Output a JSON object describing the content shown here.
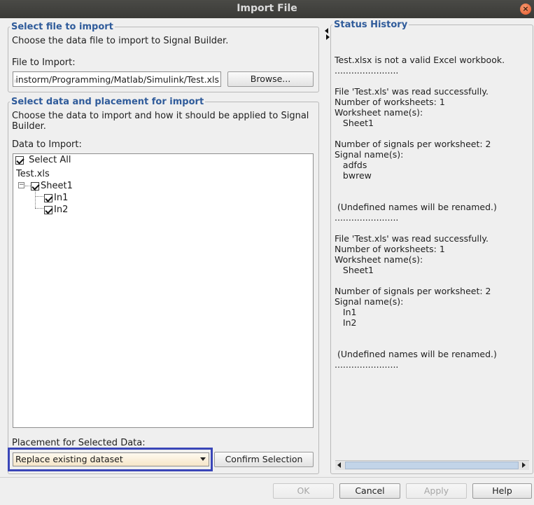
{
  "window": {
    "title": "Import File",
    "close_icon": "close-icon"
  },
  "file_section": {
    "legend": "Select file to import",
    "description": "Choose the data file to import to Signal Builder.",
    "file_label": "File to Import:",
    "file_value": "ainstorm/Programming/Matlab/Simulink/Test.xls",
    "browse_label": "Browse..."
  },
  "data_section": {
    "legend": "Select data and placement for import",
    "description_line1": "Choose the data to import and how it should be applied to Signal",
    "description_line2": "Builder.",
    "data_label": "Data to Import:",
    "select_all_label": "Select All",
    "tree": {
      "file": "Test.xls",
      "sheet": "Sheet1",
      "signals": [
        "In1",
        "In2"
      ]
    },
    "placement_label": "Placement for Selected Data:",
    "placement_value": "Replace existing dataset",
    "confirm_label": "Confirm Selection"
  },
  "status": {
    "legend": "Status History",
    "text": "\nTest.xlsx is not a valid Excel workbook.\n.......................\n\nFile 'Test.xls' was read successfully.\nNumber of worksheets: 1\nWorksheet name(s):\n   Sheet1\n\nNumber of signals per worksheet: 2\nSignal name(s):\n   adfds\n   bwrew\n\n\n (Undefined names will be renamed.)\n.......................\n\nFile 'Test.xls' was read successfully.\nNumber of worksheets: 1\nWorksheet name(s):\n   Sheet1\n\nNumber of signals per worksheet: 2\nSignal name(s):\n   In1\n   In2\n\n\n (Undefined names will be renamed.)\n......................."
  },
  "buttons": {
    "ok": "OK",
    "cancel": "Cancel",
    "apply": "Apply",
    "help": "Help"
  },
  "colors": {
    "legend": "#2f5b9a",
    "highlight": "#3a46b8",
    "titlebar": "#3c3c39"
  }
}
